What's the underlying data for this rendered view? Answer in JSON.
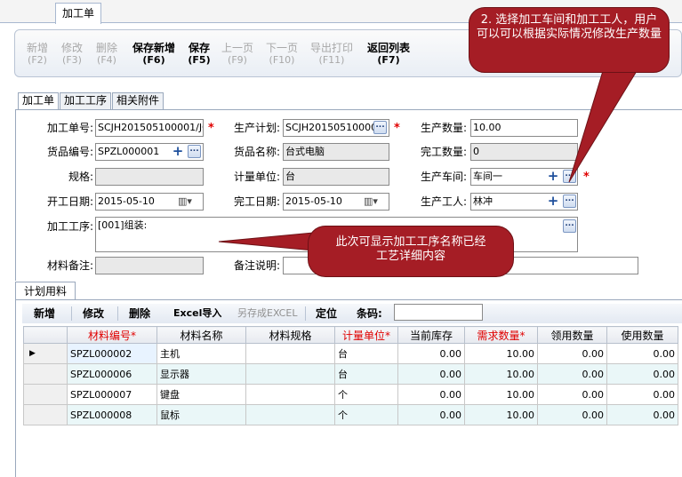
{
  "doc_tab": "加工单",
  "toolbar": {
    "buttons": [
      {
        "label": "新增",
        "key": "(F2)"
      },
      {
        "label": "修改",
        "key": "(F3)"
      },
      {
        "label": "删除",
        "key": "(F4)"
      },
      {
        "label": "保存新增",
        "key": "(F6)"
      },
      {
        "label": "保存",
        "key": "(F5)"
      },
      {
        "label": "上一页",
        "key": "(F9)"
      },
      {
        "label": "下一页",
        "key": "(F10)"
      },
      {
        "label": "导出打印",
        "key": "(F11)"
      },
      {
        "label": "返回列表",
        "key": "(F7)"
      }
    ]
  },
  "section_tabs": [
    "加工单",
    "加工工序",
    "相关附件"
  ],
  "form": {
    "labels": {
      "order_no": "加工单号:",
      "plan": "生产计划:",
      "quantity": "生产数量:",
      "goods_no": "货品编号:",
      "goods_name": "货品名称:",
      "done_qty": "完工数量:",
      "spec": "规格:",
      "unit": "计量单位:",
      "workshop": "生产车间:",
      "start_date": "开工日期:",
      "end_date": "完工日期:",
      "worker": "生产工人:",
      "process": "加工工序:",
      "material_note": "材料备注:",
      "remark": "备注说明:"
    },
    "values": {
      "order_no": "SCJH201505100001/JG(",
      "plan": "SCJH201505100001",
      "quantity": "10.00",
      "goods_no": "SPZL000001",
      "goods_name": "台式电脑",
      "done_qty": "0",
      "spec": "",
      "unit": "台",
      "workshop": "车间一",
      "start_date": "2015-05-10",
      "end_date": "2015-05-10",
      "worker": "林冲",
      "process": "[001]组装:",
      "material_note": "",
      "remark": ""
    }
  },
  "plan_tab": "计划用料",
  "grid_toolbar": {
    "add": "新增",
    "edit": "修改",
    "delete": "删除",
    "excel_import": "Excel导入",
    "save_excel": "另存成EXCEL",
    "locate": "定位",
    "barcode_label": "条码:"
  },
  "grid": {
    "headers": [
      "材料编号*",
      "材料名称",
      "材料规格",
      "计量单位*",
      "当前库存",
      "需求数量*",
      "领用数量",
      "使用数量"
    ],
    "rows": [
      [
        "SPZL000002",
        "主机",
        "",
        "台",
        "0.00",
        "10.00",
        "0.00",
        "0.00"
      ],
      [
        "SPZL000006",
        "显示器",
        "",
        "台",
        "0.00",
        "10.00",
        "0.00",
        "0.00"
      ],
      [
        "SPZL000007",
        "键盘",
        "",
        "个",
        "0.00",
        "10.00",
        "0.00",
        "0.00"
      ],
      [
        "SPZL000008",
        "鼠标",
        "",
        "个",
        "0.00",
        "10.00",
        "0.00",
        "0.00"
      ]
    ]
  },
  "callouts": {
    "top": "2. 选择加工车间和加工工人，用户可以可以根据实际情况修改生产数量",
    "middle": "此次可显示加工工序名称已经工艺详细内容"
  },
  "colors": {
    "callout_bg": "#a51d25",
    "required_star": "#e00000",
    "selected_row": "#e8f3ff",
    "alt_row": "#eaf7f8"
  }
}
